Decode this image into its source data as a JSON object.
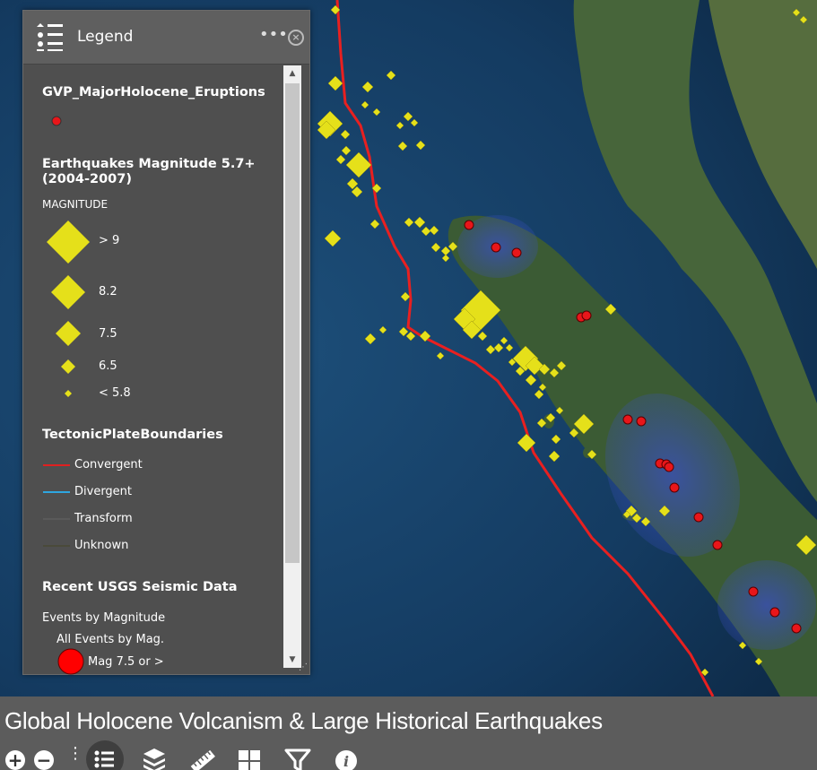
{
  "app": {
    "title": "Global Holocene Volcanism & Large Historical Earthquakes"
  },
  "legend": {
    "title": "Legend",
    "more_label": "•••",
    "close_label": "×",
    "sections": {
      "volcano": {
        "title": "GVP_MajorHolocene_Eruptions"
      },
      "quakes": {
        "title_line1": "Earthquakes Magnitude 5.7+",
        "title_line2": "(2004-2007)",
        "caption": "MAGNITUDE",
        "items": [
          "> 9",
          "8.2",
          "7.5",
          "6.5",
          "< 5.8"
        ]
      },
      "plates": {
        "title": "TectonicPlateBoundaries",
        "items": [
          {
            "label": "Convergent",
            "color": "#e02020"
          },
          {
            "label": "Divergent",
            "color": "#2ea6e0"
          },
          {
            "label": "Transform",
            "color": "#5a5a5a"
          },
          {
            "label": "Unknown",
            "color": "#4a4a3a"
          }
        ]
      },
      "usgs": {
        "title": "Recent USGS Seismic Data",
        "subtitle": "Events by Magnitude",
        "group": "All Events by Mag.",
        "item": "Mag 7.5 or >"
      }
    }
  },
  "colors": {
    "quake_fill": "#e5e01a",
    "volcano_fill": "#e8161a",
    "plate_line": "#e82020",
    "panel_bg": "#4f4f4f",
    "bottom_bar": "#5c5c5c"
  },
  "toolbar": {
    "zoom_in": "+",
    "zoom_out": "−",
    "more": "⋮",
    "tools": [
      "legend-icon",
      "layers-icon",
      "measure-icon",
      "basemap-gallery-icon",
      "filter-icon",
      "info-icon"
    ]
  }
}
